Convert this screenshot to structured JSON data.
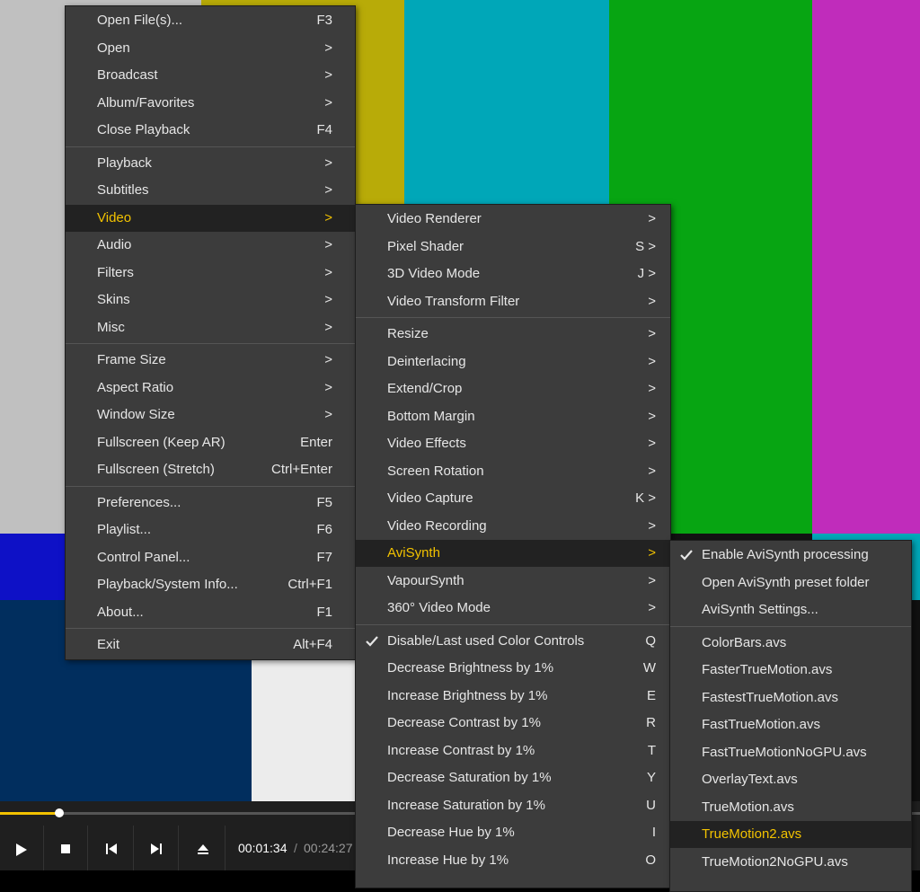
{
  "colors": {
    "accent": "#f2c200",
    "menu_bg": "#3c3c3c",
    "highlight_bg": "#222222",
    "text": "#e6e6e6"
  },
  "main_menu": {
    "items": [
      {
        "label": "Open File(s)...",
        "shortcut": "F3"
      },
      {
        "label": "Open",
        "shortcut": ">"
      },
      {
        "label": "Broadcast",
        "shortcut": ">"
      },
      {
        "label": "Album/Favorites",
        "shortcut": ">"
      },
      {
        "label": "Close Playback",
        "shortcut": "F4"
      },
      {
        "label": "Playback",
        "shortcut": ">"
      },
      {
        "label": "Subtitles",
        "shortcut": ">"
      },
      {
        "label": "Video",
        "shortcut": ">"
      },
      {
        "label": "Audio",
        "shortcut": ">"
      },
      {
        "label": "Filters",
        "shortcut": ">"
      },
      {
        "label": "Skins",
        "shortcut": ">"
      },
      {
        "label": "Misc",
        "shortcut": ">"
      },
      {
        "label": "Frame Size",
        "shortcut": ">"
      },
      {
        "label": "Aspect Ratio",
        "shortcut": ">"
      },
      {
        "label": "Window Size",
        "shortcut": ">"
      },
      {
        "label": "Fullscreen (Keep AR)",
        "shortcut": "Enter"
      },
      {
        "label": "Fullscreen (Stretch)",
        "shortcut": "Ctrl+Enter"
      },
      {
        "label": "Preferences...",
        "shortcut": "F5"
      },
      {
        "label": "Playlist...",
        "shortcut": "F6"
      },
      {
        "label": "Control Panel...",
        "shortcut": "F7"
      },
      {
        "label": "Playback/System Info...",
        "shortcut": "Ctrl+F1"
      },
      {
        "label": "About...",
        "shortcut": "F1"
      },
      {
        "label": "Exit",
        "shortcut": "Alt+F4"
      }
    ]
  },
  "video_menu": {
    "items": [
      {
        "label": "Video Renderer",
        "shortcut": ">"
      },
      {
        "label": "Pixel Shader",
        "shortcut": "S >"
      },
      {
        "label": "3D Video Mode",
        "shortcut": "J >"
      },
      {
        "label": "Video Transform Filter",
        "shortcut": ">"
      },
      {
        "label": "Resize",
        "shortcut": ">"
      },
      {
        "label": "Deinterlacing",
        "shortcut": ">"
      },
      {
        "label": "Extend/Crop",
        "shortcut": ">"
      },
      {
        "label": "Bottom Margin",
        "shortcut": ">"
      },
      {
        "label": "Video Effects",
        "shortcut": ">"
      },
      {
        "label": "Screen Rotation",
        "shortcut": ">"
      },
      {
        "label": "Video Capture",
        "shortcut": "K >"
      },
      {
        "label": "Video Recording",
        "shortcut": ">"
      },
      {
        "label": "AviSynth",
        "shortcut": ">"
      },
      {
        "label": "VapourSynth",
        "shortcut": ">"
      },
      {
        "label": "360° Video Mode",
        "shortcut": ">"
      },
      {
        "label": "Disable/Last used Color Controls",
        "shortcut": "Q"
      },
      {
        "label": "Decrease Brightness by 1%",
        "shortcut": "W"
      },
      {
        "label": "Increase Brightness by 1%",
        "shortcut": "E"
      },
      {
        "label": "Decrease Contrast by 1%",
        "shortcut": "R"
      },
      {
        "label": "Increase Contrast by 1%",
        "shortcut": "T"
      },
      {
        "label": "Decrease Saturation by 1%",
        "shortcut": "Y"
      },
      {
        "label": "Increase Saturation by 1%",
        "shortcut": "U"
      },
      {
        "label": "Decrease Hue by 1%",
        "shortcut": "I"
      },
      {
        "label": "Increase Hue by 1%",
        "shortcut": "O"
      }
    ]
  },
  "avisynth_menu": {
    "items": [
      {
        "label": "Enable AviSynth processing"
      },
      {
        "label": "Open AviSynth preset folder"
      },
      {
        "label": "AviSynth Settings..."
      },
      {
        "label": "ColorBars.avs"
      },
      {
        "label": "FasterTrueMotion.avs"
      },
      {
        "label": "FastestTrueMotion.avs"
      },
      {
        "label": "FastTrueMotion.avs"
      },
      {
        "label": "FastTrueMotionNoGPU.avs"
      },
      {
        "label": "OverlayText.avs"
      },
      {
        "label": "TrueMotion.avs"
      },
      {
        "label": "TrueMotion2.avs"
      },
      {
        "label": "TrueMotion2NoGPU.avs"
      }
    ]
  },
  "player": {
    "current_time": "00:01:34",
    "separator": "/",
    "total_time": "00:24:27",
    "progress_fraction": 0.0641
  }
}
